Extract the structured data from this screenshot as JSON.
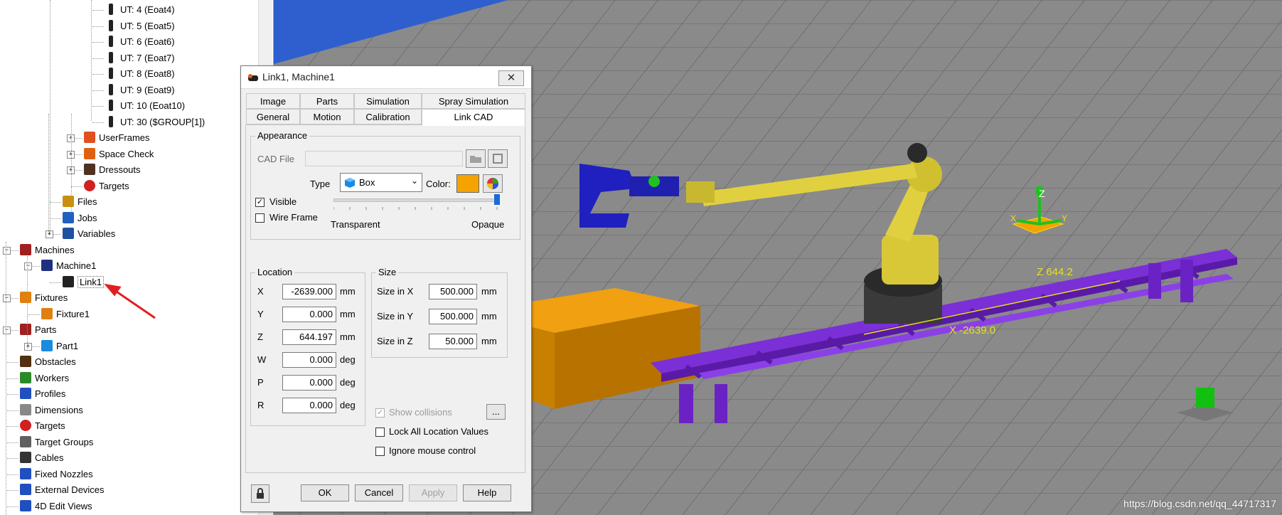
{
  "tree": {
    "items": [
      {
        "label": "UT: 4  (Eoat4)",
        "icon": "tool-icon"
      },
      {
        "label": "UT: 5  (Eoat5)",
        "icon": "tool-icon"
      },
      {
        "label": "UT: 6  (Eoat6)",
        "icon": "tool-icon"
      },
      {
        "label": "UT: 7  (Eoat7)",
        "icon": "tool-icon"
      },
      {
        "label": "UT: 8  (Eoat8)",
        "icon": "tool-icon"
      },
      {
        "label": "UT: 9  (Eoat9)",
        "icon": "tool-icon"
      },
      {
        "label": "UT: 10  (Eoat10)",
        "icon": "tool-icon"
      },
      {
        "label": "UT: 30  ($GROUP[1])",
        "icon": "tool-icon"
      },
      {
        "label": "UserFrames",
        "icon": "userframes-icon"
      },
      {
        "label": "Space Check",
        "icon": "space-check-icon"
      },
      {
        "label": "Dressouts",
        "icon": "dressouts-icon"
      },
      {
        "label": "Targets",
        "icon": "target-icon"
      },
      {
        "label": "Files",
        "icon": "files-icon"
      },
      {
        "label": "Jobs",
        "icon": "jobs-icon"
      },
      {
        "label": "Variables",
        "icon": "variables-icon"
      },
      {
        "label": "Machines",
        "icon": "machines-icon"
      },
      {
        "label": "Machine1",
        "icon": "machine-icon"
      },
      {
        "label": "Link1",
        "icon": "link-icon"
      },
      {
        "label": "Fixtures",
        "icon": "fixtures-icon"
      },
      {
        "label": "Fixture1",
        "icon": "fixture-icon"
      },
      {
        "label": "Parts",
        "icon": "parts-icon"
      },
      {
        "label": "Part1",
        "icon": "part-cube-icon"
      },
      {
        "label": "Obstacles",
        "icon": "obstacles-icon"
      },
      {
        "label": "Workers",
        "icon": "workers-icon"
      },
      {
        "label": "Profiles",
        "icon": "profiles-icon"
      },
      {
        "label": "Dimensions",
        "icon": "dimensions-icon"
      },
      {
        "label": "Targets",
        "icon": "target-icon"
      },
      {
        "label": "Target Groups",
        "icon": "target-groups-icon"
      },
      {
        "label": "Cables",
        "icon": "cables-icon"
      },
      {
        "label": "Fixed Nozzles",
        "icon": "nozzle-icon"
      },
      {
        "label": "External Devices",
        "icon": "external-devices-icon"
      },
      {
        "label": "4D Edit Views",
        "icon": "edit-views-icon"
      }
    ]
  },
  "dialog": {
    "title": "Link1, Machine1",
    "close": "✕",
    "tabs_row1": [
      "Image",
      "Parts",
      "Simulation",
      "Spray Simulation"
    ],
    "tabs_row2": [
      "General",
      "Motion",
      "Calibration",
      "Link CAD"
    ],
    "active_tab": "Link CAD",
    "appearance": {
      "group": "Appearance",
      "cad_file_label": "CAD File",
      "cad_file_value": "",
      "type_label": "Type",
      "type_value": "Box",
      "color_label": "Color:",
      "color_value": "#f5a300",
      "visible_label": "Visible",
      "visible_checked": true,
      "wireframe_label": "Wire Frame",
      "wireframe_checked": false,
      "transparent_label": "Transparent",
      "opaque_label": "Opaque",
      "opacity": 1.0
    },
    "location": {
      "group": "Location",
      "rows": [
        {
          "label": "X",
          "value": "-2639.000",
          "unit": "mm"
        },
        {
          "label": "Y",
          "value": "0.000",
          "unit": "mm"
        },
        {
          "label": "Z",
          "value": "644.197",
          "unit": "mm"
        },
        {
          "label": "W",
          "value": "0.000",
          "unit": "deg"
        },
        {
          "label": "P",
          "value": "0.000",
          "unit": "deg"
        },
        {
          "label": "R",
          "value": "0.000",
          "unit": "deg"
        }
      ]
    },
    "size": {
      "group": "Size",
      "rows": [
        {
          "label": "Size in X",
          "value": "500.000",
          "unit": "mm"
        },
        {
          "label": "Size in Y",
          "value": "500.000",
          "unit": "mm"
        },
        {
          "label": "Size in Z",
          "value": "50.000",
          "unit": "mm"
        }
      ]
    },
    "show_collisions_label": "Show collisions",
    "ellipsis": "...",
    "lock_label": "Lock All Location Values",
    "ignore_mouse_label": "Ignore mouse control",
    "buttons": {
      "ok": "OK",
      "cancel": "Cancel",
      "apply": "Apply",
      "help": "Help"
    }
  },
  "viewport": {
    "z_label": "Z 644.2",
    "x_label": "X -2639.0",
    "axis_z": "Z",
    "axis_x": "X",
    "axis_y": "Y",
    "watermark": "https://blog.csdn.net/qq_44717317"
  },
  "colors": {
    "viewport_bg": "#8a8a8a",
    "track": "#7b2fd6",
    "robot": "#e0d040",
    "box": "#d08a00",
    "gripper": "#2020c0",
    "annotation": "#e8e020",
    "arrow": "#e02020"
  }
}
